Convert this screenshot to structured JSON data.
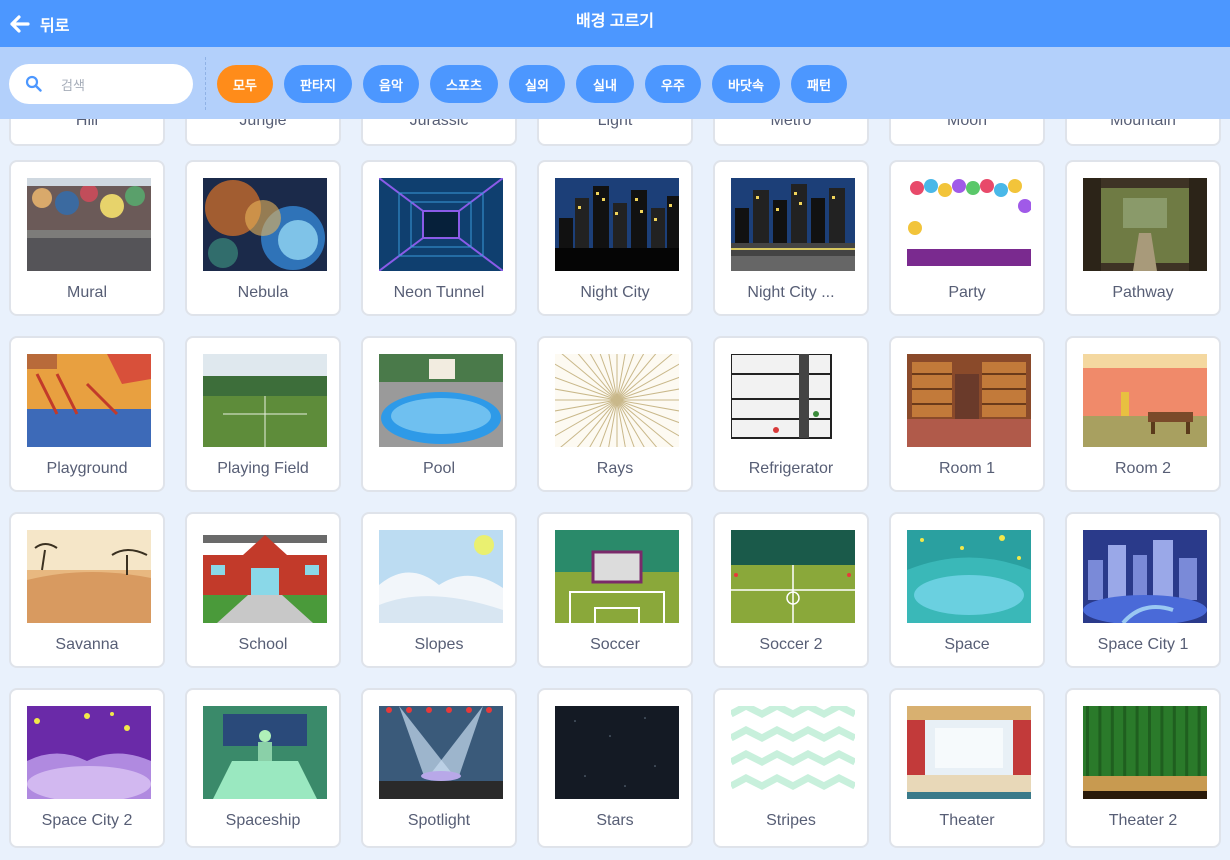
{
  "header": {
    "back_label": "뒤로",
    "title": "배경 고르기"
  },
  "search": {
    "placeholder": "검색",
    "value": ""
  },
  "tags": [
    "모두",
    "판타지",
    "음악",
    "스포츠",
    "실외",
    "실내",
    "우주",
    "바닷속",
    "패턴"
  ],
  "active_tag": "모두",
  "partial_row": [
    "Hill",
    "Jungle",
    "Jurassic",
    "Light",
    "Metro",
    "Moon",
    "Mountain"
  ],
  "backdrops": [
    {
      "name": "Mural",
      "thumb": "mural"
    },
    {
      "name": "Nebula",
      "thumb": "nebula"
    },
    {
      "name": "Neon Tunnel",
      "thumb": "neon-tunnel"
    },
    {
      "name": "Night City",
      "thumb": "night-city"
    },
    {
      "name": "Night City ...",
      "thumb": "night-city-street"
    },
    {
      "name": "Party",
      "thumb": "party"
    },
    {
      "name": "Pathway",
      "thumb": "pathway"
    },
    {
      "name": "Playground",
      "thumb": "playground"
    },
    {
      "name": "Playing Field",
      "thumb": "playing-field"
    },
    {
      "name": "Pool",
      "thumb": "pool"
    },
    {
      "name": "Rays",
      "thumb": "rays"
    },
    {
      "name": "Refrigerator",
      "thumb": "refrigerator"
    },
    {
      "name": "Room 1",
      "thumb": "room-1"
    },
    {
      "name": "Room 2",
      "thumb": "room-2"
    },
    {
      "name": "Savanna",
      "thumb": "savanna"
    },
    {
      "name": "School",
      "thumb": "school"
    },
    {
      "name": "Slopes",
      "thumb": "slopes"
    },
    {
      "name": "Soccer",
      "thumb": "soccer"
    },
    {
      "name": "Soccer 2",
      "thumb": "soccer-2"
    },
    {
      "name": "Space",
      "thumb": "space"
    },
    {
      "name": "Space City 1",
      "thumb": "space-city-1"
    },
    {
      "name": "Space City 2",
      "thumb": "space-city-2"
    },
    {
      "name": "Spaceship",
      "thumb": "spaceship"
    },
    {
      "name": "Spotlight",
      "thumb": "spotlight"
    },
    {
      "name": "Stars",
      "thumb": "stars"
    },
    {
      "name": "Stripes",
      "thumb": "stripes"
    },
    {
      "name": "Theater",
      "thumb": "theater"
    },
    {
      "name": "Theater 2",
      "thumb": "theater-2"
    }
  ],
  "colors": {
    "header": "#4c97ff",
    "filter_bar": "#b3d0fb",
    "active_tag": "#ff8c1a",
    "tag": "#4c97ff",
    "page_bg": "#e9f1fc",
    "label_text": "#575e75"
  }
}
